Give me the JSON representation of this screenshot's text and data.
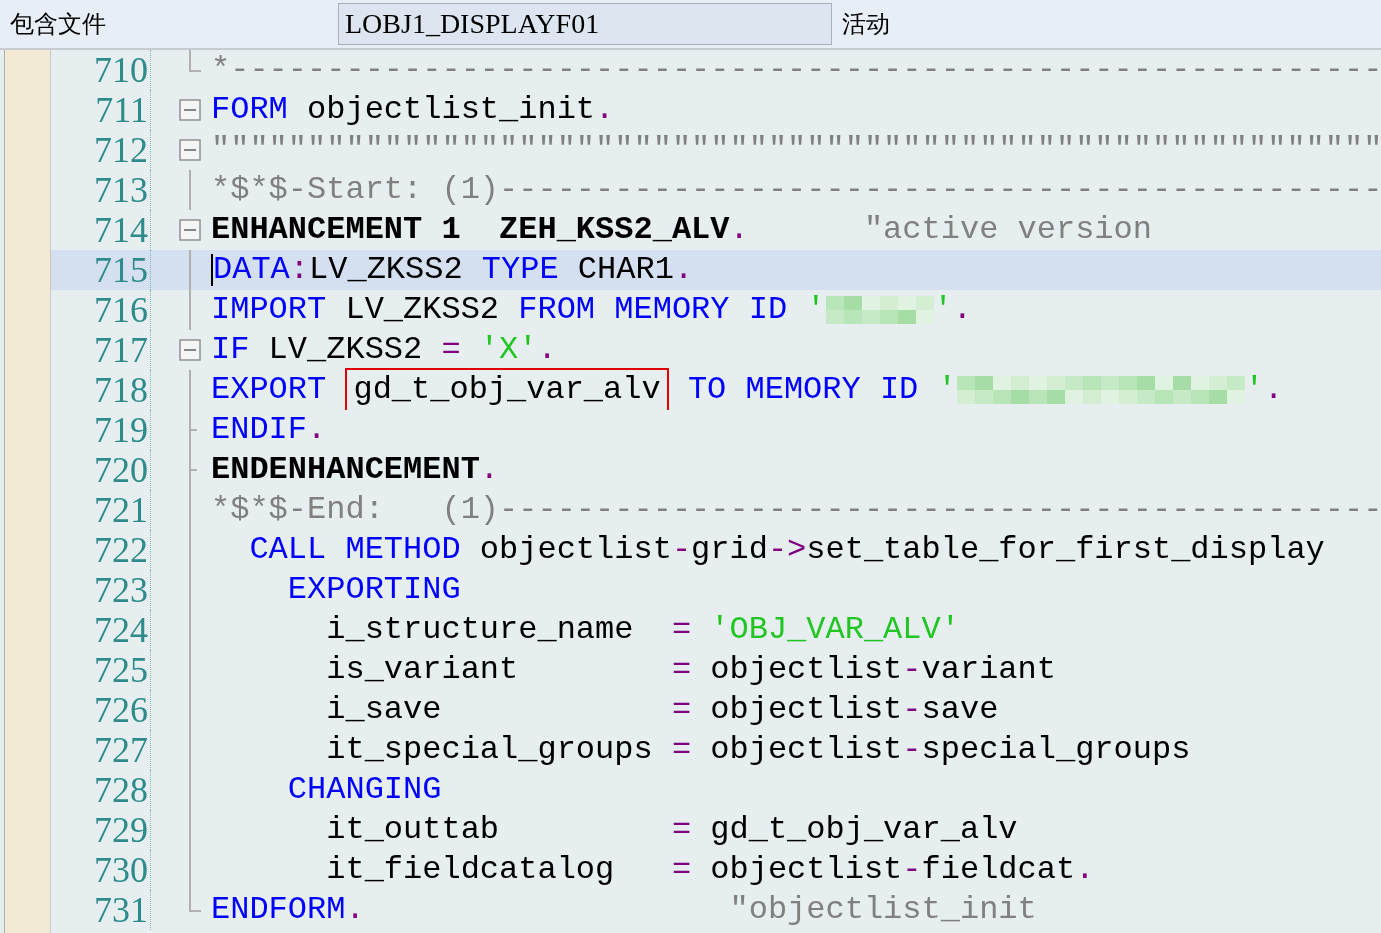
{
  "header": {
    "label": "包含文件",
    "program": "LOBJ1_DISPLAYF01",
    "status": "活动"
  },
  "lines": [
    {
      "number": "710",
      "fold": {
        "kind": "corner"
      },
      "highlighted": false,
      "tokens": [
        {
          "text": "*------------------------------------------------------------",
          "kind": "comment"
        }
      ]
    },
    {
      "number": "711",
      "fold": {
        "kind": "box"
      },
      "highlighted": false,
      "tokens": [
        {
          "text": "FORM",
          "kind": "keyword"
        },
        {
          "text": " objectlist_init",
          "kind": "plain"
        },
        {
          "text": ".",
          "kind": "punct"
        }
      ]
    },
    {
      "number": "712",
      "fold": {
        "kind": "box"
      },
      "highlighted": false,
      "tokens": [
        {
          "text": "\"\"\"\"\"\"\"\"\"\"\"\"\"\"\"\"\"\"\"\"\"\"\"\"\"\"\"\"\"\"\"\"\"\"\"\"\"\"\"\"\"\"\"\"\"\"\"\"\"\"\"\"\"\"\"\"\"\"\"\"\"",
          "kind": "comment"
        }
      ]
    },
    {
      "number": "713",
      "fold": {
        "kind": "line"
      },
      "highlighted": false,
      "tokens": [
        {
          "text": "*$*$-Start: (1)----------------------------------------------",
          "kind": "comment"
        }
      ]
    },
    {
      "number": "714",
      "fold": {
        "kind": "box"
      },
      "highlighted": false,
      "tokens": [
        {
          "text": "ENHANCEMENT 1  ZEH_KSS2_ALV",
          "kind": "bold"
        },
        {
          "text": ".",
          "kind": "punct"
        },
        {
          "text": "      \"active version",
          "kind": "comment"
        }
      ]
    },
    {
      "number": "715",
      "fold": {
        "kind": "line"
      },
      "highlighted": true,
      "tokens": [
        {
          "text": "DATA",
          "kind": "keyword"
        },
        {
          "text": ":",
          "kind": "punct"
        },
        {
          "text": "LV_ZKSS2 ",
          "kind": "plain"
        },
        {
          "text": "TYPE",
          "kind": "keyword"
        },
        {
          "text": " CHAR1",
          "kind": "plain"
        },
        {
          "text": ".",
          "kind": "punct"
        }
      ]
    },
    {
      "number": "716",
      "fold": {
        "kind": "line"
      },
      "highlighted": false,
      "tokens": [
        {
          "text": "IMPORT",
          "kind": "keyword"
        },
        {
          "text": " LV_ZKSS2 ",
          "kind": "plain"
        },
        {
          "text": "FROM MEMORY ID",
          "kind": "keyword"
        },
        {
          "text": " '",
          "kind": "string"
        },
        {
          "kind": "blur"
        },
        {
          "text": "'",
          "kind": "string"
        },
        {
          "text": ".",
          "kind": "punct"
        }
      ]
    },
    {
      "number": "717",
      "fold": {
        "kind": "box"
      },
      "highlighted": false,
      "tokens": [
        {
          "text": "IF",
          "kind": "keyword"
        },
        {
          "text": " LV_ZKSS2 ",
          "kind": "plain"
        },
        {
          "text": "=",
          "kind": "punct"
        },
        {
          "text": " 'X'",
          "kind": "string"
        },
        {
          "text": ".",
          "kind": "punct"
        }
      ]
    },
    {
      "number": "718",
      "fold": {
        "kind": "line"
      },
      "highlighted": false,
      "tokens": [
        {
          "text": "EXPORT ",
          "kind": "keyword"
        },
        {
          "text": "gd_t_obj_var_alv",
          "kind": "boxed"
        },
        {
          "text": " TO MEMORY ID",
          "kind": "keyword"
        },
        {
          "text": " '",
          "kind": "string"
        },
        {
          "kind": "blurwide"
        },
        {
          "text": "'",
          "kind": "string"
        },
        {
          "text": ".",
          "kind": "punct"
        }
      ]
    },
    {
      "number": "719",
      "fold": {
        "kind": "tick"
      },
      "highlighted": false,
      "tokens": [
        {
          "text": "ENDIF",
          "kind": "keyword"
        },
        {
          "text": ".",
          "kind": "punct"
        }
      ]
    },
    {
      "number": "720",
      "fold": {
        "kind": "tick"
      },
      "highlighted": false,
      "tokens": [
        {
          "text": "ENDENHANCEMENT",
          "kind": "bold"
        },
        {
          "text": ".",
          "kind": "punct"
        }
      ]
    },
    {
      "number": "721",
      "fold": {
        "kind": "line"
      },
      "highlighted": false,
      "tokens": [
        {
          "text": "*$*$-End:   (1)----------------------------------------------",
          "kind": "comment"
        }
      ]
    },
    {
      "number": "722",
      "fold": {
        "kind": "line"
      },
      "highlighted": false,
      "tokens": [
        {
          "text": "  CALL METHOD",
          "kind": "keyword"
        },
        {
          "text": " objectlist",
          "kind": "plain"
        },
        {
          "text": "-",
          "kind": "punct"
        },
        {
          "text": "grid",
          "kind": "plain"
        },
        {
          "text": "->",
          "kind": "punct"
        },
        {
          "text": "set_table_for_first_display",
          "kind": "plain"
        }
      ]
    },
    {
      "number": "723",
      "fold": {
        "kind": "line"
      },
      "highlighted": false,
      "tokens": [
        {
          "text": "    EXPORTING",
          "kind": "keyword"
        }
      ]
    },
    {
      "number": "724",
      "fold": {
        "kind": "line"
      },
      "highlighted": false,
      "tokens": [
        {
          "text": "      i_structure_name  ",
          "kind": "plain"
        },
        {
          "text": "=",
          "kind": "punct"
        },
        {
          "text": " 'OBJ_VAR_ALV'",
          "kind": "string"
        }
      ]
    },
    {
      "number": "725",
      "fold": {
        "kind": "line"
      },
      "highlighted": false,
      "tokens": [
        {
          "text": "      is_variant        ",
          "kind": "plain"
        },
        {
          "text": "=",
          "kind": "punct"
        },
        {
          "text": " objectlist",
          "kind": "plain"
        },
        {
          "text": "-",
          "kind": "punct"
        },
        {
          "text": "variant",
          "kind": "plain"
        }
      ]
    },
    {
      "number": "726",
      "fold": {
        "kind": "line"
      },
      "highlighted": false,
      "tokens": [
        {
          "text": "      i_save            ",
          "kind": "plain"
        },
        {
          "text": "=",
          "kind": "punct"
        },
        {
          "text": " objectlist",
          "kind": "plain"
        },
        {
          "text": "-",
          "kind": "punct"
        },
        {
          "text": "save",
          "kind": "plain"
        }
      ]
    },
    {
      "number": "727",
      "fold": {
        "kind": "line"
      },
      "highlighted": false,
      "tokens": [
        {
          "text": "      it_special_groups ",
          "kind": "plain"
        },
        {
          "text": "=",
          "kind": "punct"
        },
        {
          "text": " objectlist",
          "kind": "plain"
        },
        {
          "text": "-",
          "kind": "punct"
        },
        {
          "text": "special_groups",
          "kind": "plain"
        }
      ]
    },
    {
      "number": "728",
      "fold": {
        "kind": "line"
      },
      "highlighted": false,
      "tokens": [
        {
          "text": "    CHANGING",
          "kind": "keyword"
        }
      ]
    },
    {
      "number": "729",
      "fold": {
        "kind": "line"
      },
      "highlighted": false,
      "tokens": [
        {
          "text": "      it_outtab         ",
          "kind": "plain"
        },
        {
          "text": "=",
          "kind": "punct"
        },
        {
          "text": " gd_t_obj_var_alv",
          "kind": "plain"
        }
      ]
    },
    {
      "number": "730",
      "fold": {
        "kind": "line"
      },
      "highlighted": false,
      "tokens": [
        {
          "text": "      it_fieldcatalog   ",
          "kind": "plain"
        },
        {
          "text": "=",
          "kind": "punct"
        },
        {
          "text": " objectlist",
          "kind": "plain"
        },
        {
          "text": "-",
          "kind": "punct"
        },
        {
          "text": "fieldcat",
          "kind": "plain"
        },
        {
          "text": ".",
          "kind": "punct"
        }
      ]
    },
    {
      "number": "731",
      "fold": {
        "kind": "corner"
      },
      "highlighted": false,
      "tokens": [
        {
          "text": "ENDFORM",
          "kind": "keyword"
        },
        {
          "text": ".",
          "kind": "punct"
        },
        {
          "text": "                   \"objectlist_init",
          "kind": "comment"
        }
      ]
    }
  ]
}
